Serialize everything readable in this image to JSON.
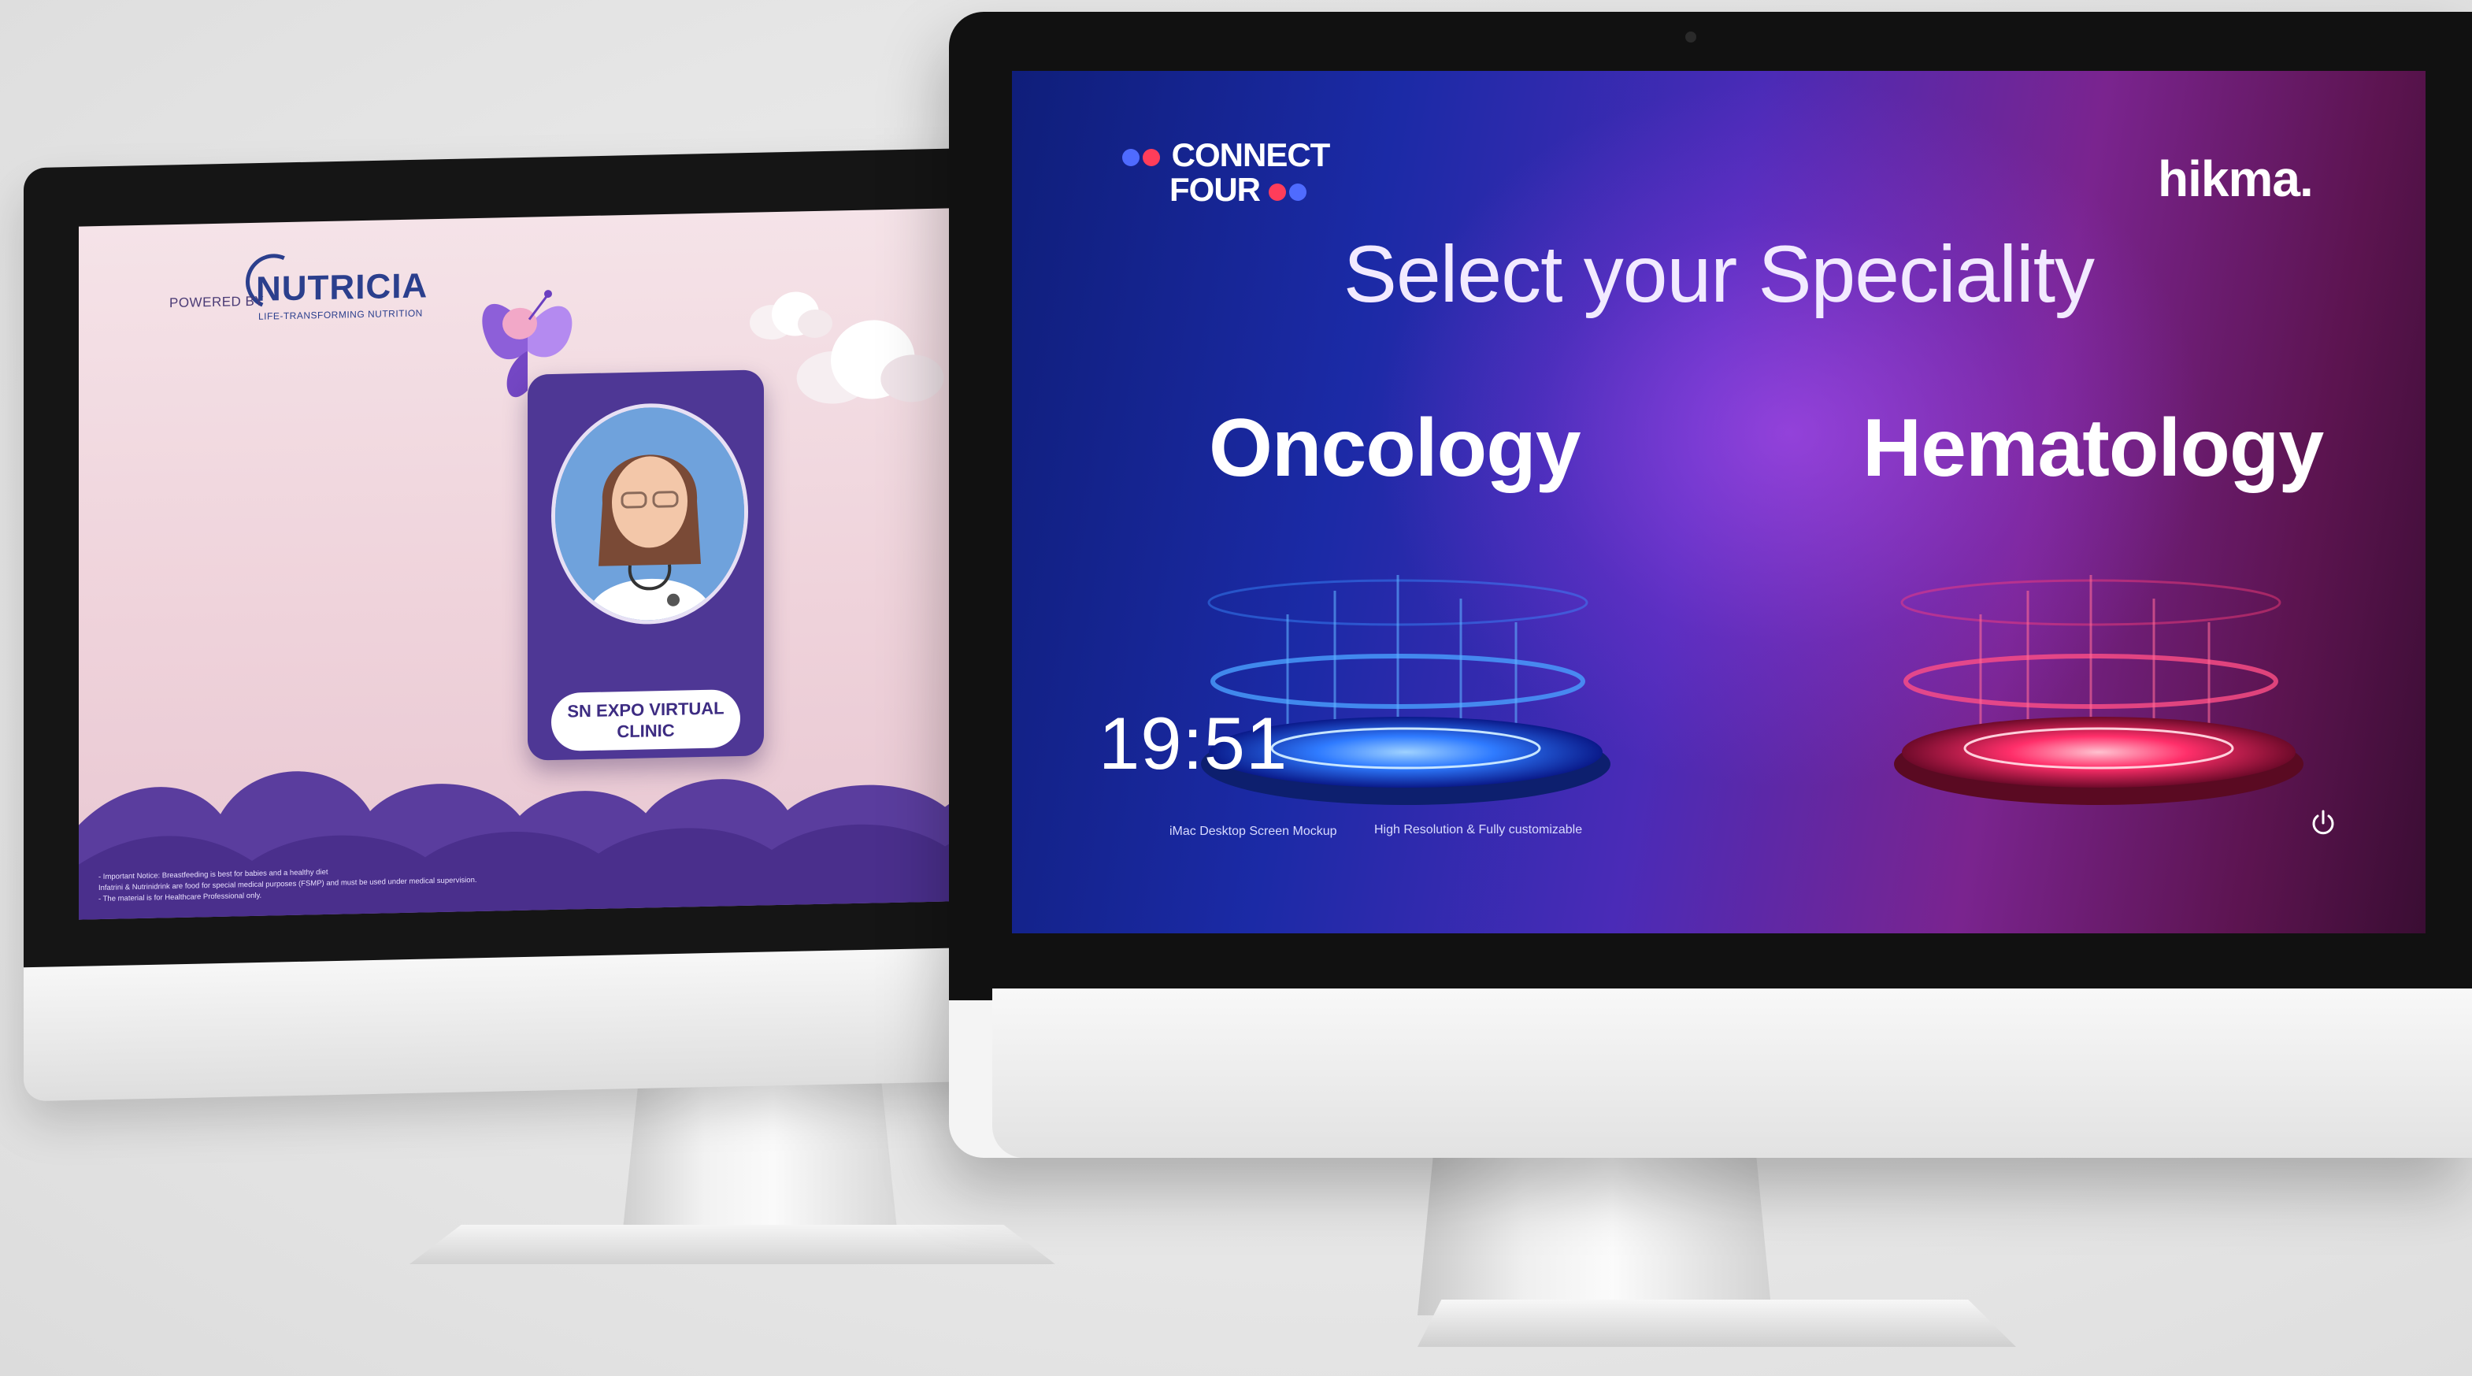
{
  "left_screen": {
    "powered_by": "POWERED BY",
    "brand": "NUTRICIA",
    "brand_tagline": "LIFE-TRANSFORMING NUTRITION",
    "clinic_button": "SN EXPO VIRTUAL CLINIC",
    "notice_lines": [
      "- Important Notice: Breastfeeding is best for babies and a healthy diet",
      "Infatrini & Nutrinidrink are food for special medical purposes (FSMP) and must be used under medical supervision.",
      "- The material is for Healthcare Professional only."
    ],
    "colors": {
      "card": "#4e3795",
      "brand": "#2b3f8d",
      "clouds": "#5a3d9e"
    }
  },
  "right_screen": {
    "logo_line1": "CONNECT",
    "logo_line2": "FOUR",
    "partner_logo": "hikma.",
    "title": "Select your Speciality",
    "specialities": [
      {
        "label": "Oncology",
        "color": "#2f7bff"
      },
      {
        "label": "Hematology",
        "color": "#ff2f6a"
      }
    ],
    "clock": "19:51",
    "footer_left": "iMac Desktop Screen Mockup",
    "footer_right": "High Resolution & Fully customizable",
    "power_icon": "power-icon",
    "colors": {
      "dot_blue": "#4f6bff",
      "dot_red": "#ff3d5a"
    }
  }
}
